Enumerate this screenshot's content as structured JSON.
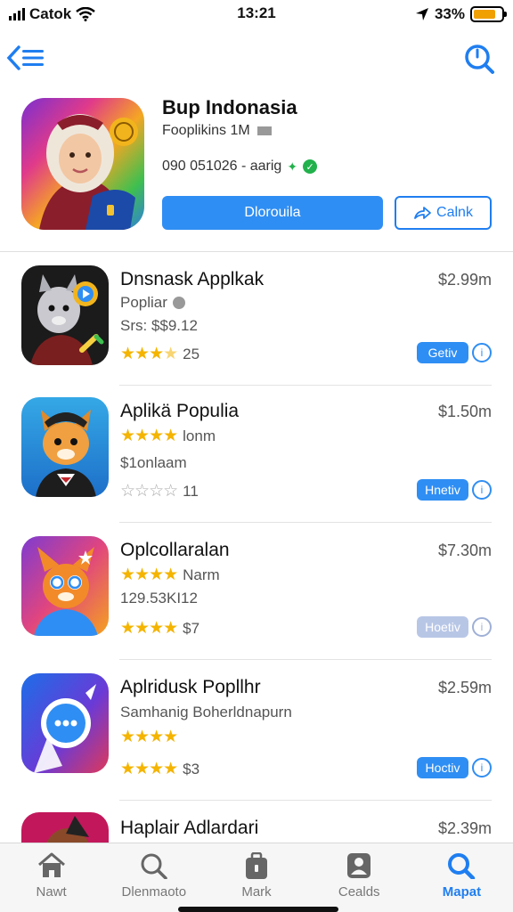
{
  "status": {
    "carrier": "Catok",
    "time": "13:21",
    "battery": "33%",
    "battery_level": 0.8
  },
  "featured": {
    "title": "Bup Indonasia",
    "subtitle": "Fooplikins 1M",
    "id_line": "090 051026 - aarig",
    "download_label": "Dlorouila",
    "share_label": "Calnk"
  },
  "apps": [
    {
      "title": "Dnsnask Applkak",
      "price": "$2.99m",
      "line1": "Popliar",
      "line2": "Srs: $$9.12",
      "rating": 3.5,
      "rating_text": "25",
      "button": "Getiv"
    },
    {
      "title": "Aplikä Populia",
      "price": "$1.50m",
      "line1": "lonm",
      "line2": "$1onlaam",
      "rating": 0,
      "rating_text": "11",
      "button": "Hnetiv"
    },
    {
      "title": "Oplcollaralan",
      "price": "$7.30m",
      "line1": "Narm",
      "line2": "129.53KI12",
      "rating": 4,
      "rating_text": "$7",
      "button": "Hoetiv"
    },
    {
      "title": "Aplridusk Popllhr",
      "price": "$2.59m",
      "line1": "",
      "line2": "Samhanig Boherldnapurn",
      "rating": 4,
      "rating_text": "$3",
      "button": "Hoctiv"
    },
    {
      "title": "Haplair Adlardari",
      "price": "$2.39m"
    }
  ],
  "tabs": [
    {
      "label": "Nawt",
      "icon": "home-icon"
    },
    {
      "label": "Dlenmaoto",
      "icon": "search-icon"
    },
    {
      "label": "Mark",
      "icon": "briefcase-icon"
    },
    {
      "label": "Cealds",
      "icon": "person-icon"
    },
    {
      "label": "Mapat",
      "icon": "search-icon"
    }
  ],
  "colors": {
    "accent": "#2f8ef3",
    "star": "#f4b400"
  }
}
